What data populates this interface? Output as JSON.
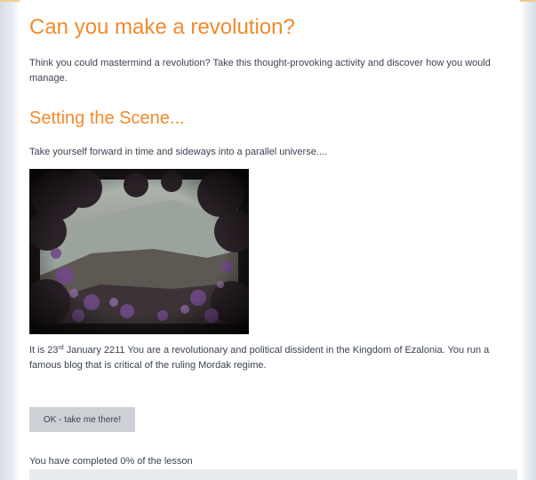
{
  "page": {
    "title": "Can you make a revolution?",
    "intro": "Think you could mastermind a revolution? Take this thought-provoking activity and discover how you would manage."
  },
  "section": {
    "heading": "Setting the Scene...",
    "lead": "Take yourself forward in time and sideways into a parallel universe...."
  },
  "story": {
    "prefix": "It is 23",
    "superscript": "rd",
    "suffix": " January 2211 You are a revolutionary and political dissident in  the Kingdom of Ezalonia. You run a famous blog that is critical of the ruling Mordak regime."
  },
  "actions": {
    "continue_label": "OK - take me there!"
  },
  "progress": {
    "text": "You have completed 0% of the lesson",
    "value": 0
  },
  "colors": {
    "heading": "#f28a2d",
    "text": "#3b4350",
    "button_bg": "#cdd1d6"
  }
}
